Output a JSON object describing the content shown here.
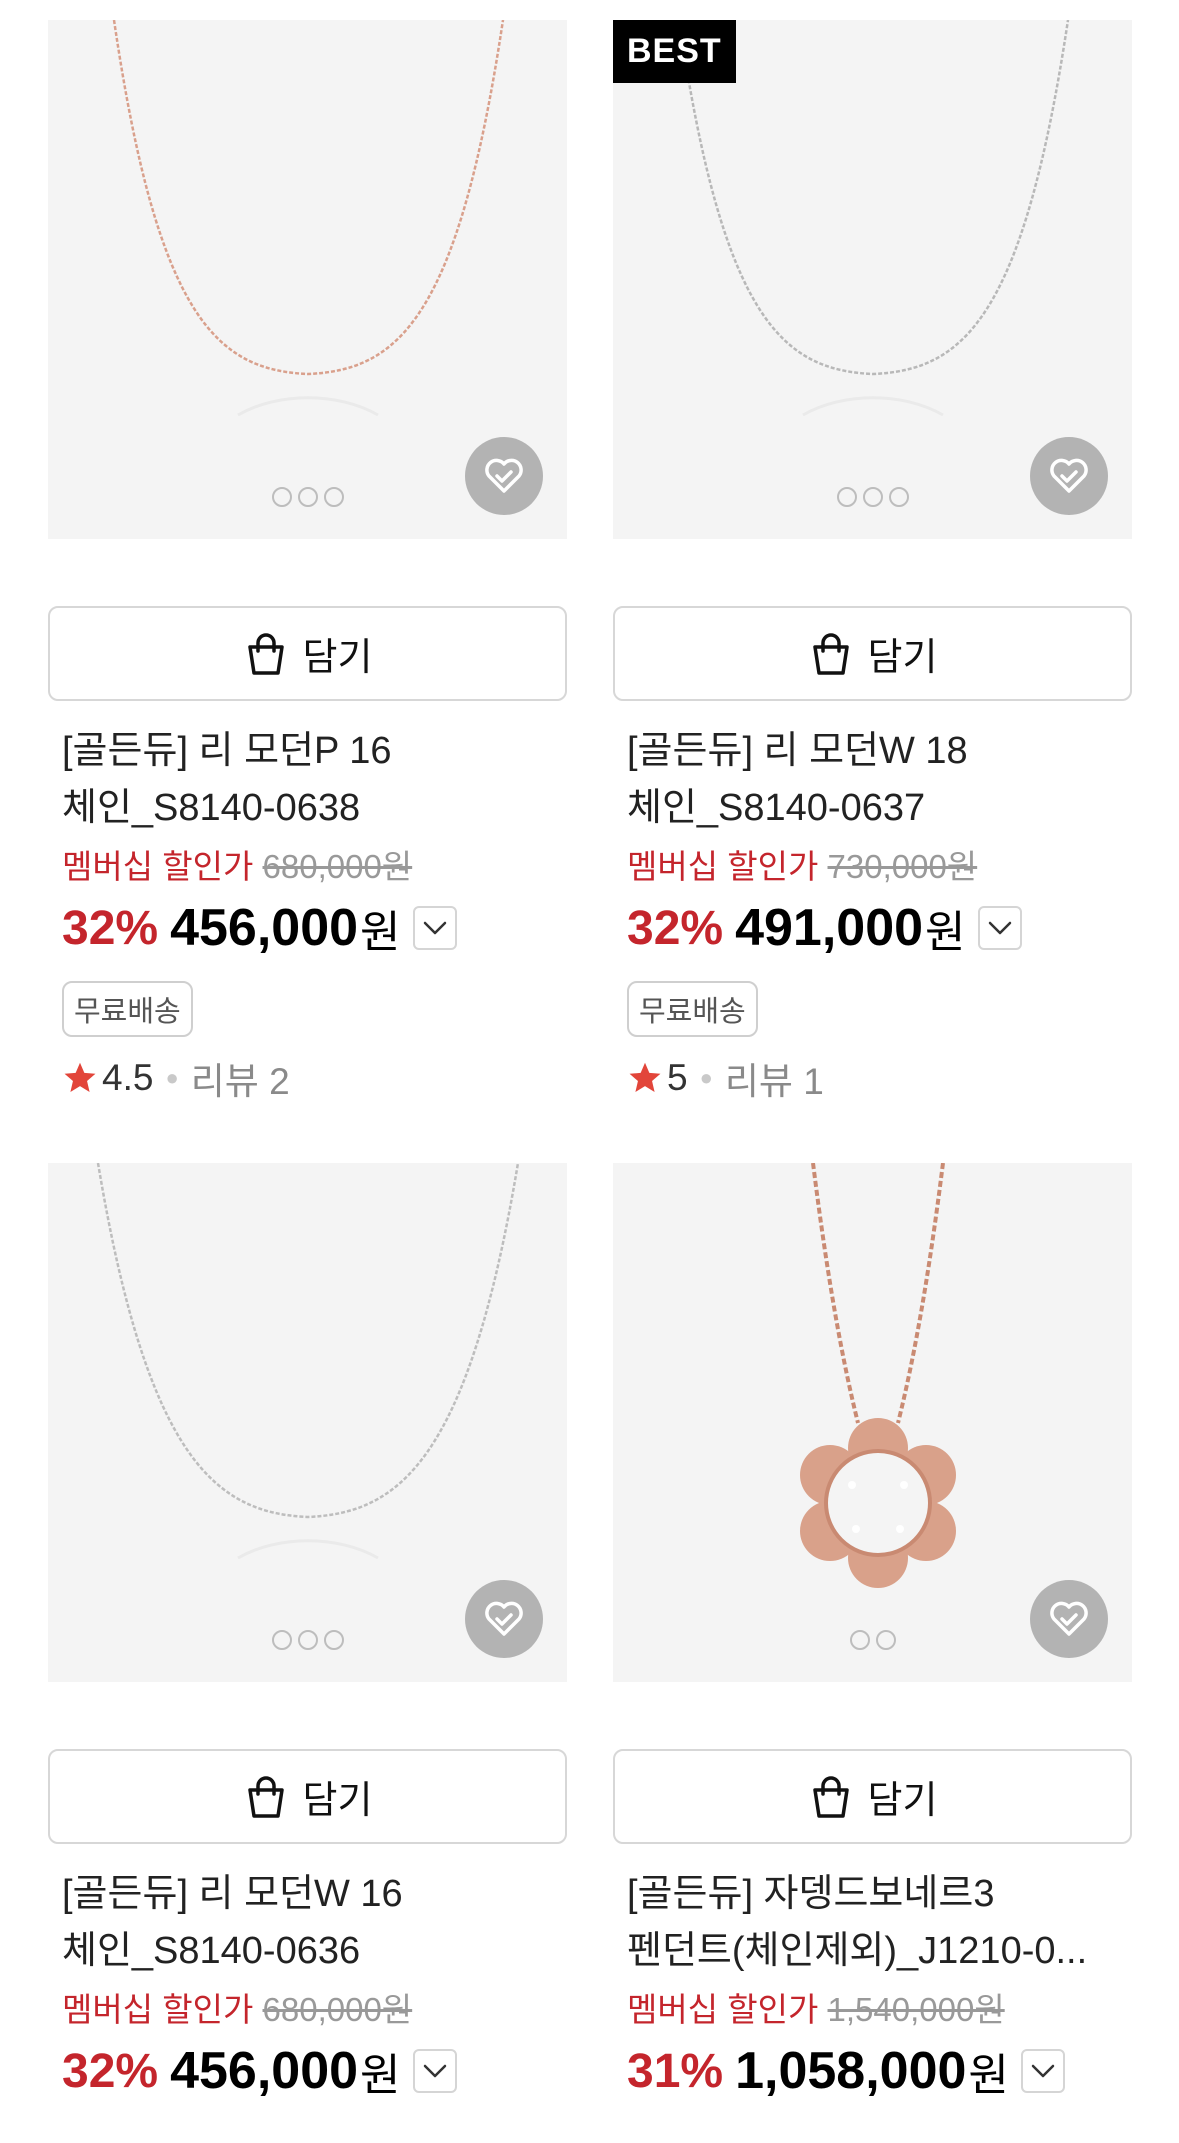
{
  "cart_label": "담기",
  "products": [
    {
      "name1": "[골든듀] 리 모던P 16",
      "name2": "체인_S8140-0638",
      "member_label": "멤버십 할인가",
      "original_price": "680,000원",
      "discount": "32%",
      "price": "456,000",
      "won": "원",
      "shipping": "무료배송",
      "rating": "4.5",
      "reviews": "리뷰 2",
      "badge": "",
      "image_dots": 3,
      "chain_color": "#d9a08c"
    },
    {
      "name1": "[골든듀] 리 모던W 18",
      "name2": "체인_S8140-0637",
      "member_label": "멤버십 할인가",
      "original_price": "730,000원",
      "discount": "32%",
      "price": "491,000",
      "won": "원",
      "shipping": "무료배송",
      "rating": "5",
      "reviews": "리뷰 1",
      "badge": "BEST",
      "image_dots": 3,
      "chain_color": "#b8b8b8"
    },
    {
      "name1": "[골든듀] 리 모던W 16",
      "name2": "체인_S8140-0636",
      "member_label": "멤버십 할인가",
      "original_price": "680,000원",
      "discount": "32%",
      "price": "456,000",
      "won": "원",
      "shipping": "",
      "rating": "",
      "reviews": "",
      "badge": "",
      "image_dots": 3,
      "chain_color": "#bdbdbd"
    },
    {
      "name1": "[골든듀] 자뎅드보네르3",
      "name2": "펜던트(체인제외)_J1210-0...",
      "member_label": "멤버십 할인가",
      "original_price": "1,540,000원",
      "discount": "31%",
      "price": "1,058,000",
      "won": "원",
      "shipping": "",
      "rating": "",
      "reviews": "",
      "badge": "",
      "image_dots": 2,
      "chain_color": "#c98a72"
    }
  ],
  "icons": {
    "wishlist": "heart-check-icon",
    "cart": "shopping-bag-icon",
    "expand": "chevron-down-icon",
    "star": "star-icon"
  },
  "colors": {
    "accent_red": "#c4252c",
    "star": "#e2453a",
    "wish_bg": "#b3b3b3"
  }
}
